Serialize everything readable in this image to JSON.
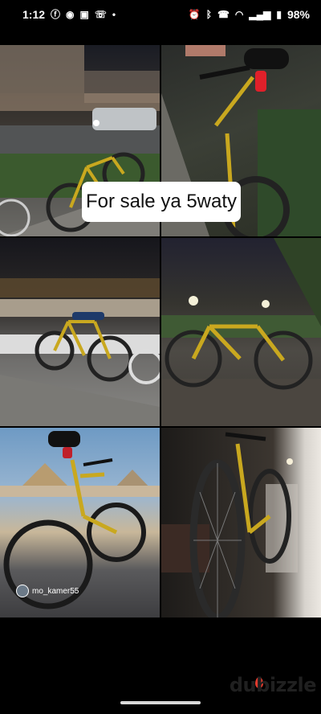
{
  "status_bar": {
    "time": "1:12",
    "battery": "98%",
    "left_icons": [
      "facebook-icon",
      "snapchat-icon",
      "instagram-icon",
      "missed-call-icon",
      "dot-icon"
    ],
    "right_icons": [
      "alarm-icon",
      "bluetooth-icon",
      "wifi-call-icon",
      "wifi-icon",
      "signal-icon",
      "battery-icon"
    ]
  },
  "caption": "For sale ya 5waty",
  "photo_watermark": "mo_kamer55",
  "app_watermark": "dubizzle",
  "colors": {
    "caption_bg": "#ffffff",
    "bike_frame": "#c9a81f",
    "brand_drop": "#e23b2e"
  }
}
